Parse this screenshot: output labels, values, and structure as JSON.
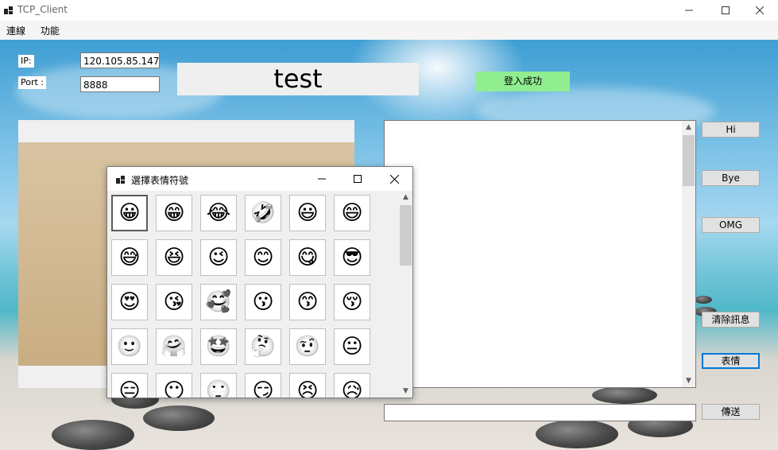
{
  "window": {
    "title": "TCP_Client"
  },
  "menu": [
    "連線",
    "功能"
  ],
  "connection": {
    "ip_label": "IP:",
    "ip_value": "120.105.85.147",
    "port_label": "Port :",
    "port_value": "8888"
  },
  "topic": "test",
  "status": "登入成功",
  "buttons": {
    "hi": "Hi",
    "bye": "Bye",
    "omg": "OMG",
    "clear": "清除訊息",
    "emoji": "表情",
    "send": "傳送"
  },
  "emoji_dialog": {
    "title": "選擇表情符號",
    "emojis": [
      "😀",
      "😁",
      "😂",
      "🤣",
      "😃",
      "😄",
      "😅",
      "😆",
      "😉",
      "😊",
      "😋",
      "😎",
      "😍",
      "😘",
      "🥰",
      "😗",
      "😙",
      "😚",
      "🙂",
      "🤗",
      "🤩",
      "🤔",
      "🤨",
      "😐",
      "😑",
      "😶",
      "🙄",
      "😏",
      "😣",
      "😥"
    ]
  },
  "colors": {
    "status_bg": "#90ee90",
    "focus_accent": "#0078d7"
  }
}
